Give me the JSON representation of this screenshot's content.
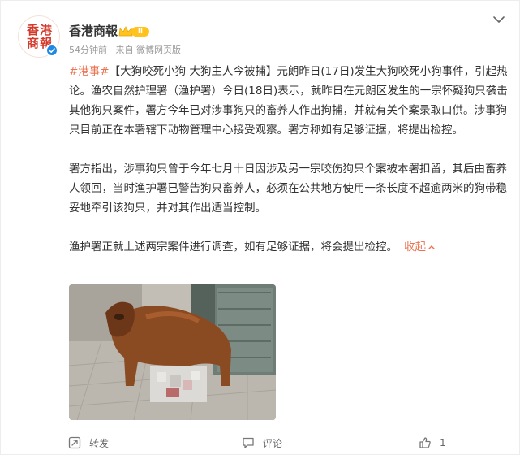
{
  "account": {
    "name": "香港商報",
    "avatar_text_line1": "香港",
    "avatar_text_line2": "商報",
    "vip_level": "II",
    "time": "54分钟前",
    "source": "来自 微博网页版"
  },
  "post": {
    "hashtag": "#港事#",
    "p1": "【大狗咬死小狗 大狗主人今被捕】元朗昨日(17日)发生大狗咬死小狗事件，引起热论。渔农自然护理署（渔护署）今日(18日)表示，就昨日在元朗区发生的一宗怀疑狗只袭击其他狗只案件，署方今年已对涉事狗只的畜养人作出拘捕，并就有关个案录取口供。涉事狗只目前正在本署辖下动物管理中心接受观察。署方称如有足够证据，将提出检控。",
    "p2": "署方指出，涉事狗只曾于今年七月十日因涉及另一宗咬伤狗只个案被本署扣留，其后由畜养人领回，当时渔护署已警告狗只畜养人，必须在公共地方使用一条长度不超逾两米的狗带稳妥地牵引该狗只，并对其作出适当控制。",
    "p3": "渔护署正就上述两宗案件进行调查，如有足够证据，将会提出检控。",
    "collapse_label": "收起"
  },
  "actions": {
    "repost_label": "转发",
    "comment_label": "评论",
    "like_count": "1"
  },
  "colors": {
    "accent_orange": "#eb7350",
    "verify_blue": "#1e88e5",
    "vip_gold": "#ffc21e",
    "muted_text": "#999999"
  },
  "icons": {
    "more": "chevron-down-icon",
    "repost": "repost-icon",
    "comment": "comment-icon",
    "like": "thumb-up-icon",
    "verify": "verified-check-icon"
  }
}
